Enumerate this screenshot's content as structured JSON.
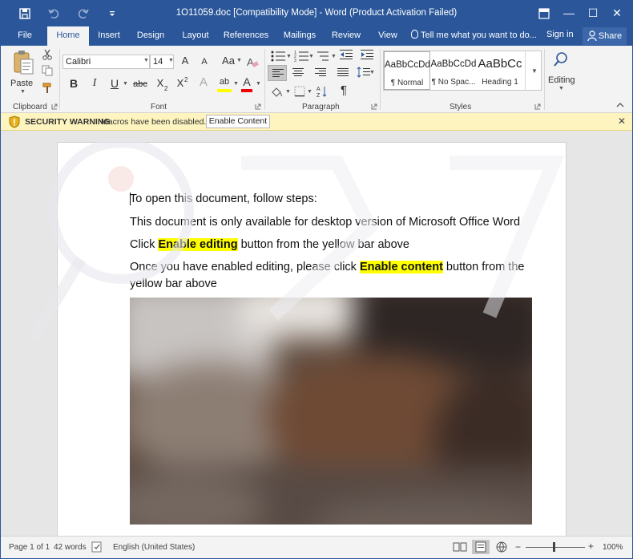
{
  "window": {
    "title": "1O11059.doc [Compatibility Mode] - Word (Product Activation Failed)",
    "min_glyph": "—",
    "max_glyph": "☐",
    "close_glyph": "✕"
  },
  "tabs": [
    {
      "label": "File"
    },
    {
      "label": "Home"
    },
    {
      "label": "Insert"
    },
    {
      "label": "Design"
    },
    {
      "label": "Layout"
    },
    {
      "label": "References"
    },
    {
      "label": "Mailings"
    },
    {
      "label": "Review"
    },
    {
      "label": "View"
    }
  ],
  "tell_me": "Tell me what you want to do...",
  "sign_in": "Sign in",
  "share": "Share",
  "ribbon": {
    "clipboard": {
      "paste_label": "Paste",
      "group_label": "Clipboard"
    },
    "font": {
      "font_name": "Calibri",
      "font_size": "14",
      "group_label": "Font",
      "grow": "A",
      "shrink": "A",
      "case": "Aa",
      "bold": "B",
      "italic": "I",
      "underline": "U",
      "strike": "abc",
      "subscript": "X",
      "subscript_mark": "2",
      "superscript": "X",
      "superscript_mark": "2",
      "effects": "A",
      "highlight": "ab",
      "font_color": "A"
    },
    "paragraph": {
      "group_label": "Paragraph",
      "pilcrow": "¶"
    },
    "styles": {
      "group_label": "Styles",
      "items": [
        {
          "sample": "AaBbCcDd",
          "name": "¶ Normal"
        },
        {
          "sample": "AaBbCcDd",
          "name": "¶ No Spac..."
        },
        {
          "sample": "AaBbCc",
          "name": "Heading 1"
        }
      ]
    },
    "editing": {
      "label": "Editing"
    }
  },
  "security_bar": {
    "warning": "SECURITY WARNING",
    "message": "Macros have been disabled.",
    "button": "Enable Content",
    "close_glyph": "✕"
  },
  "document": {
    "line1": "To open this document, follow steps:",
    "line2": "This document is only available for desktop version of Microsoft Office Word",
    "line3_pre": "Click ",
    "line3_hl": "Enable editing",
    "line3_post": " button from the yellow bar above",
    "line4_pre": "Once you have enabled editing, please click ",
    "line4_hl": "Enable content",
    "line4_post": " button from the",
    "line5": "yellow bar above"
  },
  "status": {
    "page": "Page 1 of 1",
    "words": "42 words",
    "language": "English (United States)",
    "zoom_minus": "−",
    "zoom_plus": "+",
    "zoom": "100%"
  },
  "colors": {
    "accent": "#2b579a",
    "security_bar": "#fdf4bf",
    "highlight": "#ffff00"
  }
}
